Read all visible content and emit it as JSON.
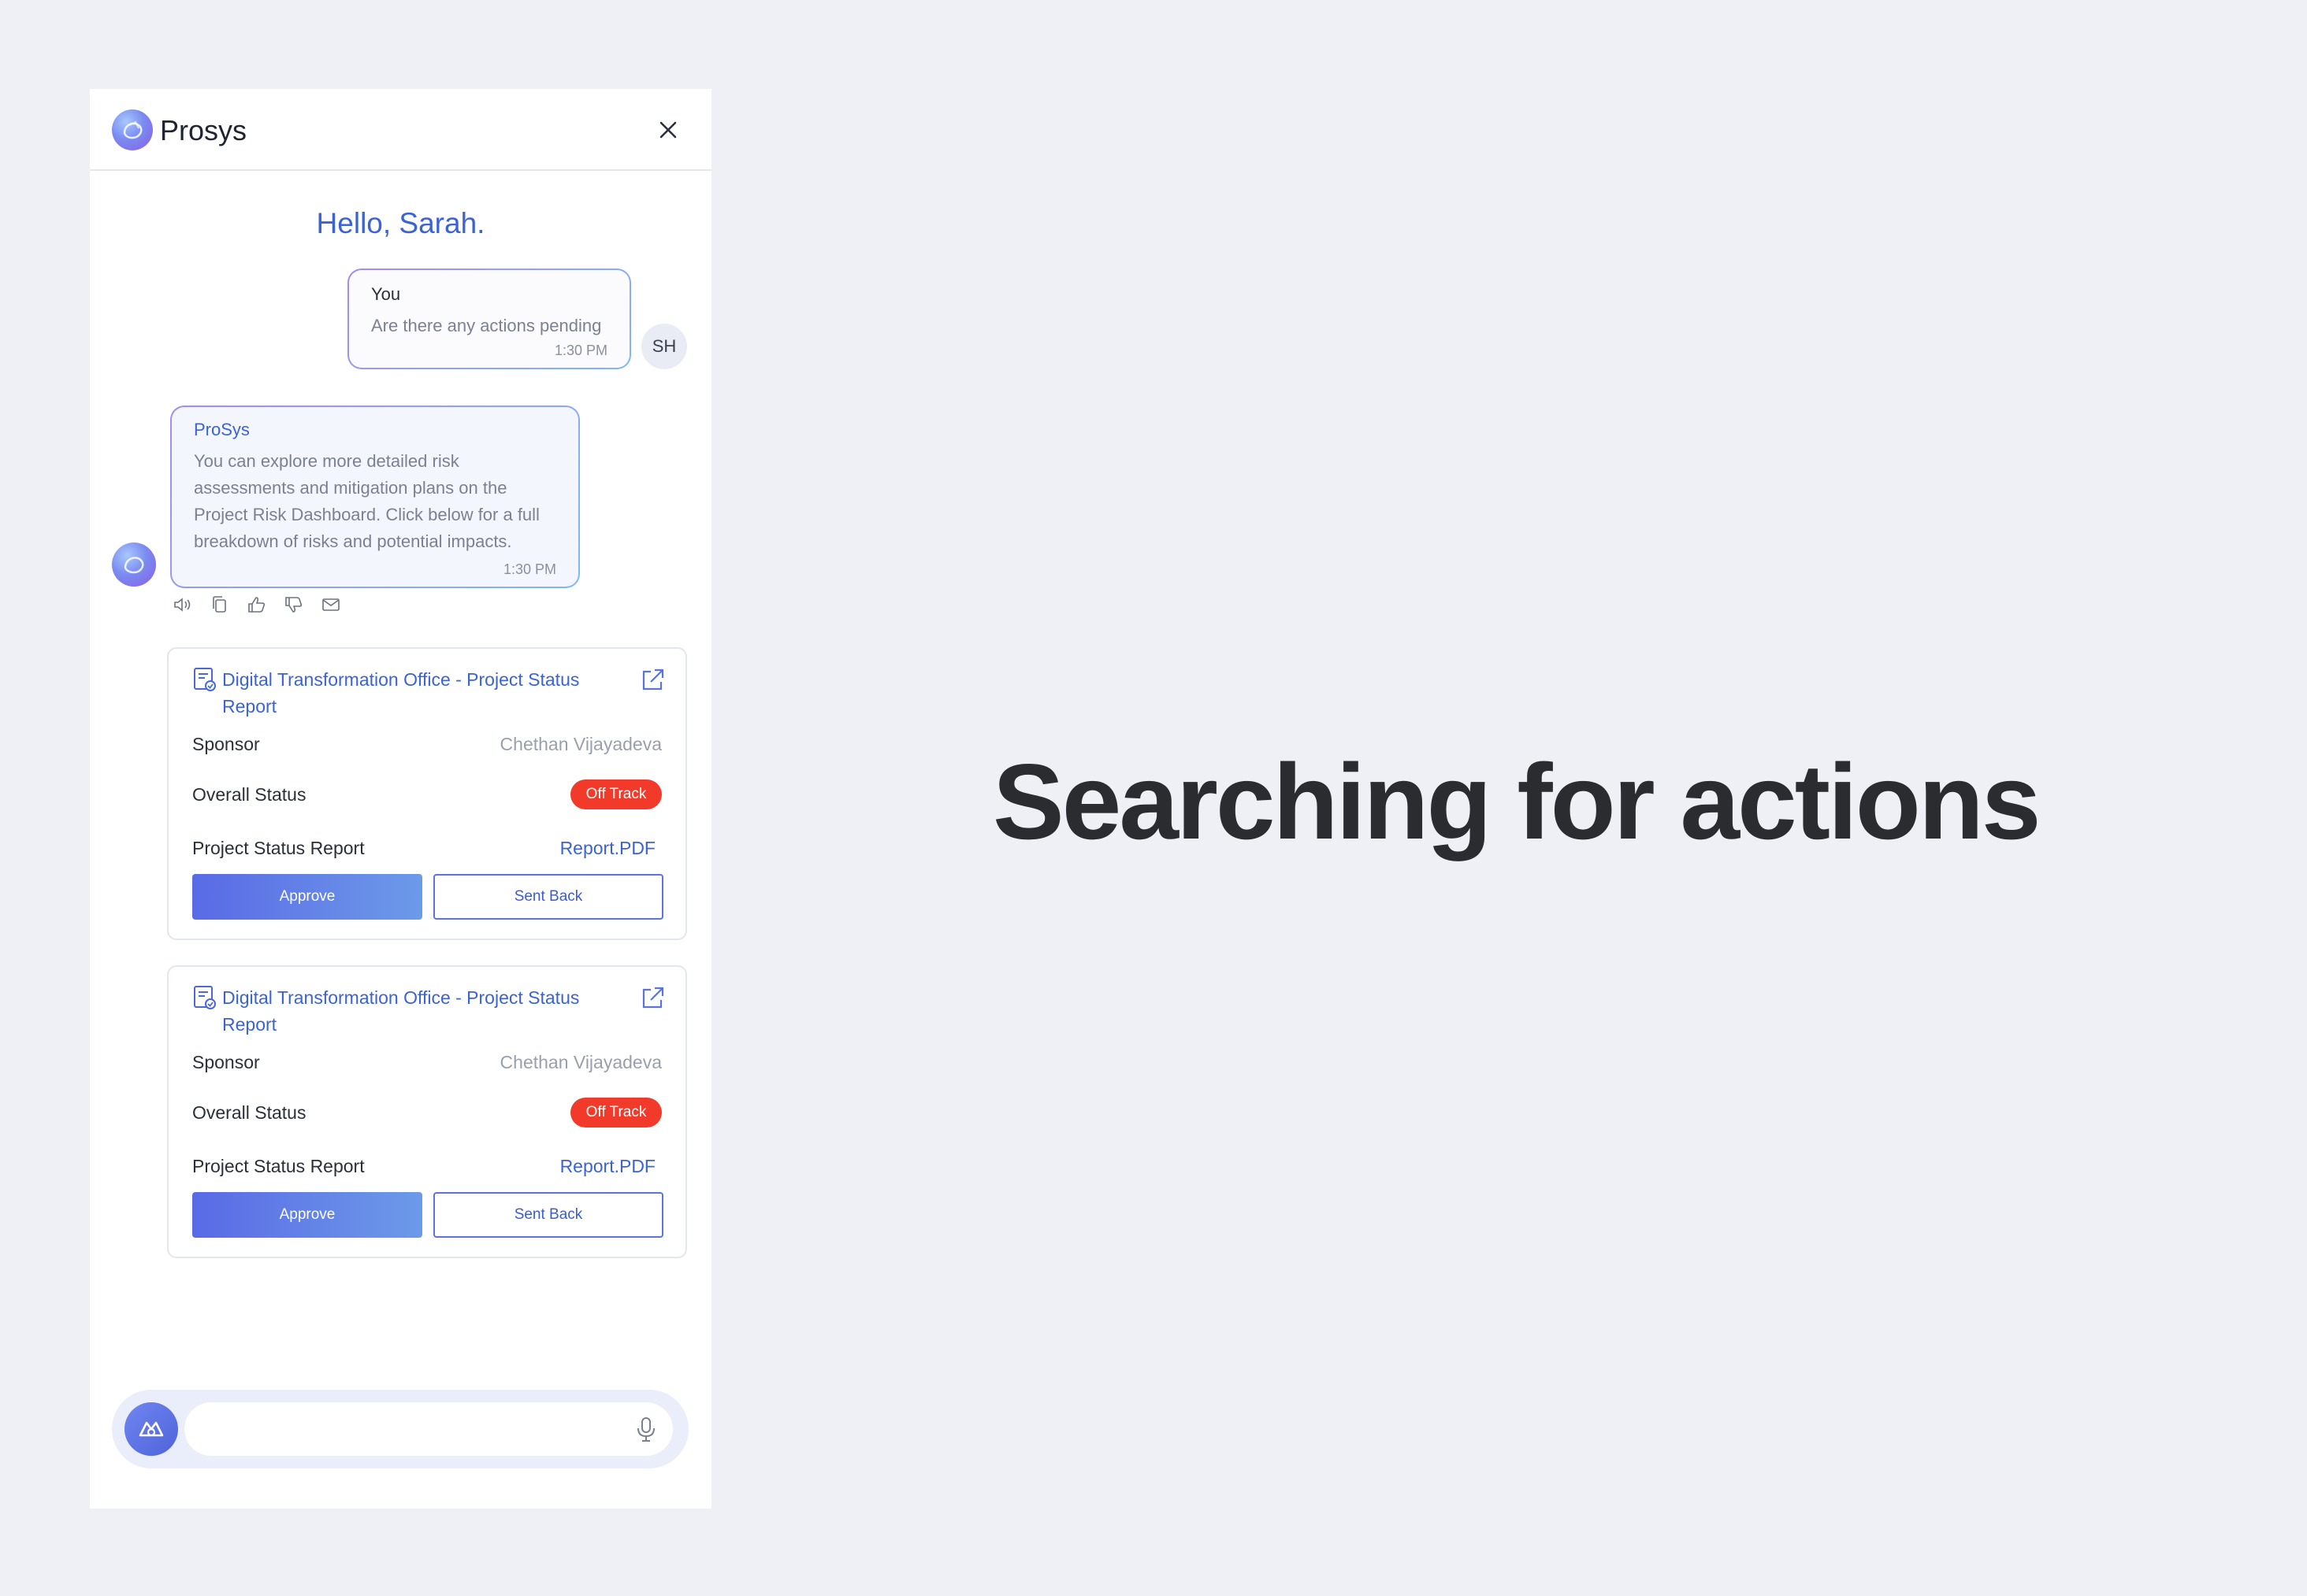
{
  "header": {
    "brand": "Prosys",
    "logo_icon": "prosys-logo-icon",
    "close_icon": "close-icon"
  },
  "greeting": "Hello, Sarah.",
  "chat": {
    "user_message": {
      "sender": "You",
      "text": "Are there any actions pending",
      "time": "1:30 PM",
      "avatar_initials": "SH"
    },
    "bot_message": {
      "sender": "ProSys",
      "text": "You can explore more detailed risk assessments and mitigation plans on the Project Risk Dashboard. Click below for a full breakdown of risks and potential impacts.",
      "time": "1:30 PM",
      "actions": [
        "speaker-icon",
        "copy-icon",
        "thumbs-up-icon",
        "thumbs-down-icon",
        "mail-icon"
      ]
    }
  },
  "cards": [
    {
      "title": "Digital Transformation Office - Project Status Report",
      "sponsor_label": "Sponsor",
      "sponsor_value": "Chethan Vijayadeva",
      "status_label": "Overall Status",
      "status_value": "Off Track",
      "report_label": "Project Status Report",
      "report_link": "Report.PDF",
      "approve_label": "Approve",
      "sent_back_label": "Sent Back"
    },
    {
      "title": "Digital Transformation Office - Project Status Report",
      "sponsor_label": "Sponsor",
      "sponsor_value": "Chethan Vijayadeva",
      "status_label": "Overall Status",
      "status_value": "Off Track",
      "report_label": "Project Status Report",
      "report_link": "Report.PDF",
      "approve_label": "Approve",
      "sent_back_label": "Sent Back"
    }
  ],
  "input": {
    "placeholder": "",
    "mic_icon": "microphone-icon",
    "app_icon": "assistant-icon"
  },
  "headline": "Searching for actions",
  "colors": {
    "accent": "#3b63d6",
    "status_off_track": "#f23a2a",
    "background": "#eef0f5"
  }
}
